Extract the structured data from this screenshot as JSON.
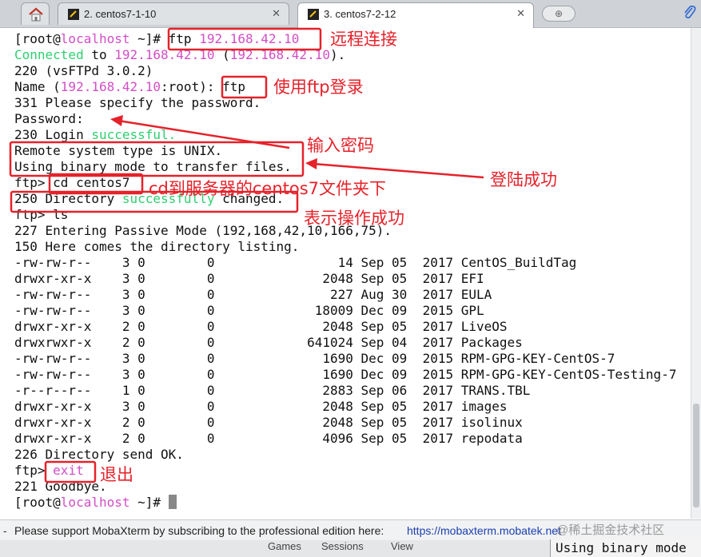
{
  "tabs": [
    {
      "label": "2. centos7-1-10",
      "active": false
    },
    {
      "label": "3. centos7-2-12",
      "active": true
    }
  ],
  "terminal": {
    "prompt_user": "[root@",
    "prompt_host": "localhost",
    "prompt_tail": " ~]#",
    "cmd_ftp_prefix": " ftp ",
    "ip": "192.168.42.10",
    "connected_word": "Connected",
    "connected_to": " to ",
    "connected_paren_open": " (",
    "connected_paren_close": ").",
    "banner": "220 (vsFTPd 3.0.2)",
    "name_prefix": "Name (",
    "name_ip": "192.168.42.10",
    "name_suffix": ":root): ",
    "name_input": "ftp",
    "specify_password": "331 Please specify the password.",
    "password_prompt": "Password:",
    "login_prefix": "230 Login ",
    "successful_word": "successful.",
    "remote_system": "Remote system type is UNIX.",
    "binary_mode": "Using binary mode to transfer files.",
    "ftp_prompt": "ftp> ",
    "cd_cmd": "cd centos7",
    "dir_changed_prefix": "250 Directory ",
    "successfully_word": "successfully",
    "dir_changed_suffix": " changed.",
    "ls_cmd": "ls",
    "passive_mode": "227 Entering Passive Mode (192,168,42,10,166,75).",
    "listing_start": "150 Here comes the directory listing.",
    "listing": [
      {
        "perms": "-rw-rw-r--",
        "links": "3",
        "owner": "0",
        "group": "0",
        "size": "14",
        "month": "Sep",
        "day": "05",
        "year": "2017",
        "name": "CentOS_BuildTag"
      },
      {
        "perms": "drwxr-xr-x",
        "links": "3",
        "owner": "0",
        "group": "0",
        "size": "2048",
        "month": "Sep",
        "day": "05",
        "year": "2017",
        "name": "EFI"
      },
      {
        "perms": "-rw-rw-r--",
        "links": "3",
        "owner": "0",
        "group": "0",
        "size": "227",
        "month": "Aug",
        "day": "30",
        "year": "2017",
        "name": "EULA"
      },
      {
        "perms": "-rw-rw-r--",
        "links": "3",
        "owner": "0",
        "group": "0",
        "size": "18009",
        "month": "Dec",
        "day": "09",
        "year": "2015",
        "name": "GPL"
      },
      {
        "perms": "drwxr-xr-x",
        "links": "2",
        "owner": "0",
        "group": "0",
        "size": "2048",
        "month": "Sep",
        "day": "05",
        "year": "2017",
        "name": "LiveOS"
      },
      {
        "perms": "drwxrwxr-x",
        "links": "2",
        "owner": "0",
        "group": "0",
        "size": "641024",
        "month": "Sep",
        "day": "04",
        "year": "2017",
        "name": "Packages"
      },
      {
        "perms": "-rw-rw-r--",
        "links": "3",
        "owner": "0",
        "group": "0",
        "size": "1690",
        "month": "Dec",
        "day": "09",
        "year": "2015",
        "name": "RPM-GPG-KEY-CentOS-7"
      },
      {
        "perms": "-rw-rw-r--",
        "links": "3",
        "owner": "0",
        "group": "0",
        "size": "1690",
        "month": "Dec",
        "day": "09",
        "year": "2015",
        "name": "RPM-GPG-KEY-CentOS-Testing-7"
      },
      {
        "perms": "-r--r--r--",
        "links": "1",
        "owner": "0",
        "group": "0",
        "size": "2883",
        "month": "Sep",
        "day": "06",
        "year": "2017",
        "name": "TRANS.TBL"
      },
      {
        "perms": "drwxr-xr-x",
        "links": "3",
        "owner": "0",
        "group": "0",
        "size": "2048",
        "month": "Sep",
        "day": "05",
        "year": "2017",
        "name": "images"
      },
      {
        "perms": "drwxr-xr-x",
        "links": "2",
        "owner": "0",
        "group": "0",
        "size": "2048",
        "month": "Sep",
        "day": "05",
        "year": "2017",
        "name": "isolinux"
      },
      {
        "perms": "drwxr-xr-x",
        "links": "2",
        "owner": "0",
        "group": "0",
        "size": "4096",
        "month": "Sep",
        "day": "05",
        "year": "2017",
        "name": "repodata"
      }
    ],
    "send_ok": "226 Directory send OK.",
    "exit_cmd": "exit",
    "goodbye": "221 Goodbye."
  },
  "annotations": {
    "remote_connect": "远程连接",
    "ftp_login": "使用ftp登录",
    "enter_password": "输入密码",
    "login_success": "登陆成功",
    "cd_dir": "cd到服务器的centos7文件夹下",
    "op_success": "表示操作成功",
    "quit": "退出"
  },
  "status_bar": {
    "message": "Please support MobaXterm by subscribing to the professional edition here:",
    "link": "https://mobaxterm.mobatek.net",
    "watermark": "@稀土掘金技术社区"
  },
  "bottom_bar": {
    "menu": [
      "Games",
      "Sessions",
      "View"
    ],
    "terminal_snippet": "Using binary mode"
  },
  "colors": {
    "annotation": "#e5222a",
    "magenta": "#d24ec6",
    "green": "#2fcf6f",
    "link": "#1a3fb0"
  }
}
